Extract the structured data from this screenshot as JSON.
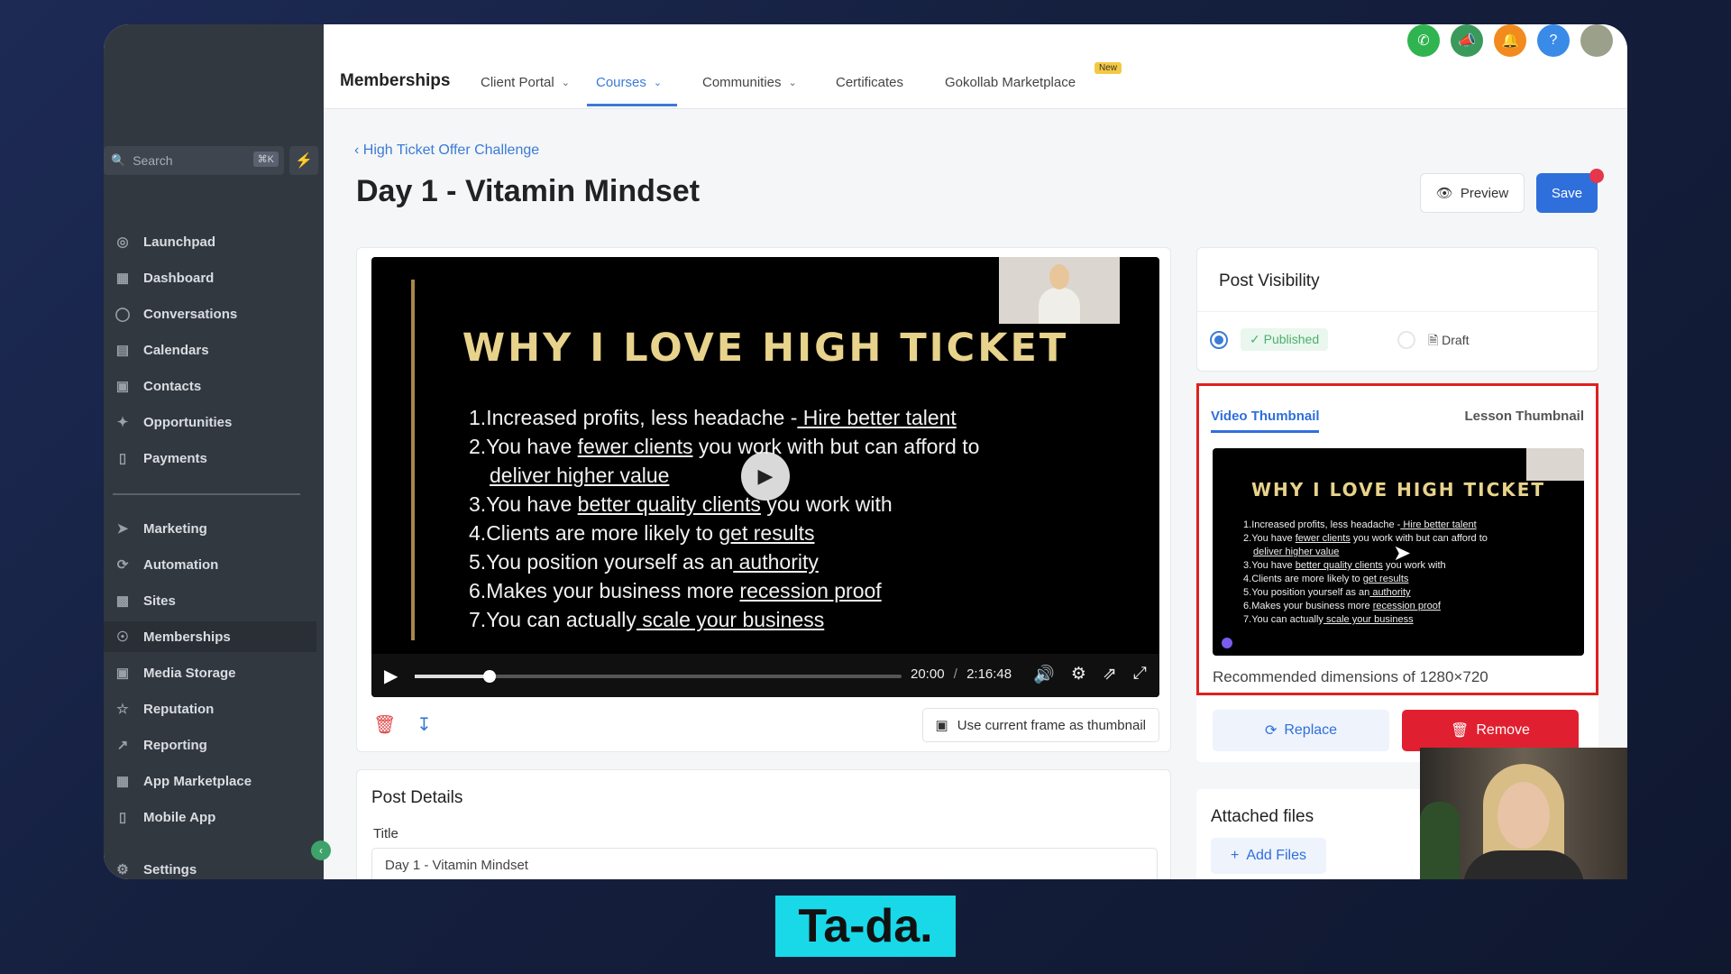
{
  "sidebar": {
    "search_placeholder": "Search",
    "search_shortcut": "⌘K",
    "items": [
      {
        "label": "Launchpad"
      },
      {
        "label": "Dashboard"
      },
      {
        "label": "Conversations"
      },
      {
        "label": "Calendars"
      },
      {
        "label": "Contacts"
      },
      {
        "label": "Opportunities"
      },
      {
        "label": "Payments"
      },
      {
        "label": "Marketing"
      },
      {
        "label": "Automation"
      },
      {
        "label": "Sites"
      },
      {
        "label": "Memberships"
      },
      {
        "label": "Media Storage"
      },
      {
        "label": "Reputation"
      },
      {
        "label": "Reporting"
      },
      {
        "label": "App Marketplace"
      },
      {
        "label": "Mobile App"
      },
      {
        "label": "Settings"
      }
    ],
    "active": "Memberships"
  },
  "topbar": {
    "brand": "Memberships",
    "tabs": [
      {
        "label": "Client Portal"
      },
      {
        "label": "Courses"
      },
      {
        "label": "Communities"
      },
      {
        "label": "Certificates"
      },
      {
        "label": "Gokollab Marketplace"
      }
    ],
    "new_badge": "New",
    "active_tab": "Courses"
  },
  "page": {
    "breadcrumb": "High Ticket Offer Challenge",
    "title": "Day 1 - Vitamin Mindset",
    "preview_label": "Preview",
    "save_label": "Save"
  },
  "video": {
    "slide_title": "WHY I LOVE HIGH TICKET",
    "slide_items": [
      {
        "num": "1.",
        "pre": "Increased profits, less headache -",
        "link": " Hire better talent",
        "post": ""
      },
      {
        "num": "2.",
        "pre": "You have ",
        "link": "fewer clients",
        "post": " you work with but can afford to"
      },
      {
        "num": "",
        "pre": "",
        "link": "deliver higher value",
        "post": ""
      },
      {
        "num": "3.",
        "pre": "You have ",
        "link": "better quality clients",
        "post": " you work with"
      },
      {
        "num": "4.",
        "pre": "Clients are more likely to ",
        "link": "get results",
        "post": ""
      },
      {
        "num": "5.",
        "pre": "You position yourself as an",
        "link": " authority",
        "post": ""
      },
      {
        "num": "6.",
        "pre": "Makes your business more ",
        "link": "recession proof",
        "post": ""
      },
      {
        "num": "7.",
        "pre": "You can actually",
        "link": " scale your business",
        "post": ""
      }
    ],
    "current_time": "20:00",
    "separator": "/",
    "duration": "2:16:48",
    "progress": 0.153,
    "use_frame_label": "Use current frame as thumbnail"
  },
  "visibility": {
    "title": "Post Visibility",
    "published_label": "Published",
    "draft_label": "Draft"
  },
  "thumbnail": {
    "tab_video": "Video Thumbnail",
    "tab_lesson": "Lesson Thumbnail",
    "recommended": "Recommended dimensions of 1280×720",
    "replace_label": "Replace",
    "remove_label": "Remove"
  },
  "details": {
    "title": "Post Details",
    "title_label": "Title",
    "title_value": "Day 1 - Vitamin Mindset"
  },
  "files": {
    "title": "Attached files",
    "add_label": "Add Files"
  },
  "caption": "Ta-da.",
  "colors": {
    "accent": "#2f6fdc",
    "danger": "#e02030",
    "sidebar": "#323840",
    "caption_bg": "#19d8e8"
  }
}
